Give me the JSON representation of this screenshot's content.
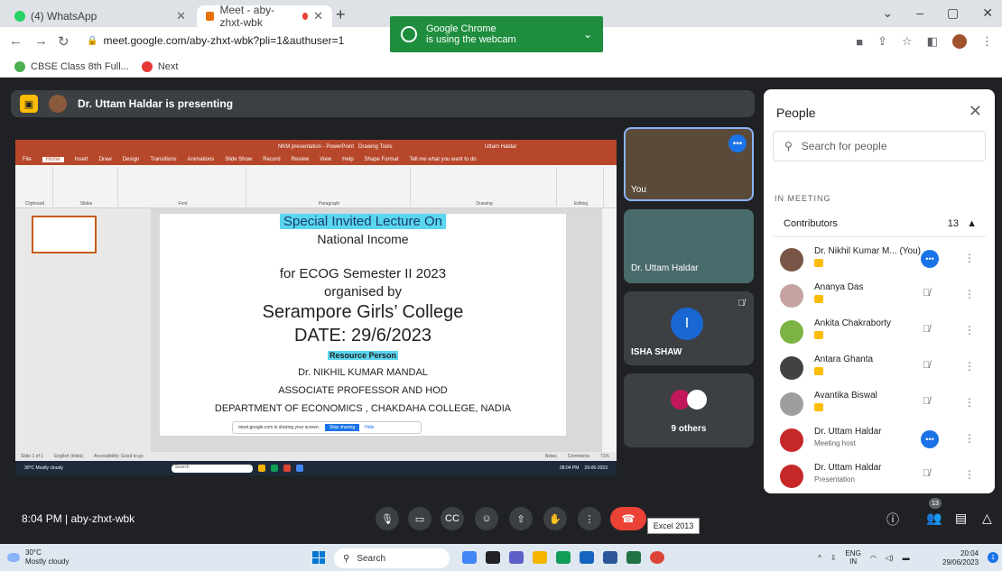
{
  "browser": {
    "tabs": [
      {
        "label": "(4) WhatsApp"
      },
      {
        "label": "Meet - aby-zhxt-wbk"
      }
    ],
    "notice": {
      "line1": "Google Chrome",
      "line2": "is using the webcam"
    },
    "url": "meet.google.com/aby-zhxt-wbk?pli=1&authuser=1",
    "bookmarks": [
      {
        "label": "CBSE Class 8th Full..."
      },
      {
        "label": "Next"
      }
    ]
  },
  "meet": {
    "presenting": "Dr. Uttam Haldar is presenting",
    "meeting_code": "8:04 PM  |  aby-zhxt-wbk",
    "tooltip": "Excel 2013",
    "participants_badge": "13"
  },
  "powerpoint": {
    "title": "NKM presentation - PowerPoint",
    "drawing_tools": "Drawing Tools",
    "user": "Uttam Haldar",
    "tabs": [
      "File",
      "Home",
      "Insert",
      "Draw",
      "Design",
      "Transitions",
      "Animations",
      "Slide Show",
      "Record",
      "Review",
      "View",
      "Help",
      "Shape Format"
    ],
    "tell_me": "Tell me what you want to do",
    "groups": [
      "Clipboard",
      "Slides",
      "Font",
      "Paragraph",
      "Drawing",
      "Editing"
    ],
    "status": [
      "Slide 1 of 1",
      "English (India)",
      "Accessibility: Good to go",
      "Notes",
      "Comments",
      "71%"
    ],
    "share_text": "meet.google.com is sharing your screen.",
    "stop_sharing": "Stop sharing",
    "hide": "Hide",
    "taskbar_weather": "30°C Mostly cloudy",
    "taskbar_search": "Search",
    "taskbar_time": "08:04 PM",
    "taskbar_date": "29-06-2023"
  },
  "slide": {
    "line1": "Special Invited Lecture  On",
    "line2": "National Income",
    "line3": "for    ECOG Semester II 2023",
    "line4": "organised by",
    "line5": "Serampore Girls’ College",
    "line6": "DATE: 29/6/2023",
    "line7": "Resource Person",
    "line8": "Dr. NIKHIL KUMAR MANDAL",
    "line9": "ASSOCIATE PROFESSOR AND HOD",
    "line10": "DEPARTMENT OF ECONOMICS , CHAKDAHA COLLEGE, NADIA"
  },
  "tiles": {
    "you": "You",
    "uttam": "Dr. Uttam Haldar",
    "isha": "ISHA SHAW",
    "isha_initial": "I",
    "others": "9 others"
  },
  "people": {
    "title": "People",
    "search_placeholder": "Search for people",
    "in_meeting": "IN MEETING",
    "contributors_label": "Contributors",
    "contributors_count": "13",
    "list": [
      {
        "name": "Dr. Nikhil Kumar M... (You)",
        "sub": "",
        "color": "#5d4037"
      },
      {
        "name": "Ananya Das",
        "sub": "",
        "color": "#c5a3a3"
      },
      {
        "name": "Ankita Chakraborty",
        "sub": "",
        "color": "#7cb342"
      },
      {
        "name": "Antara Ghanta",
        "sub": "",
        "color": "#424242"
      },
      {
        "name": "Avantika Biswal",
        "sub": "",
        "color": "#9e9e9e"
      },
      {
        "name": "Dr. Uttam Haldar",
        "sub": "Meeting host",
        "color": "#c62828"
      },
      {
        "name": "Dr. Uttam Haldar",
        "sub": "Presentation",
        "color": "#c62828"
      }
    ]
  },
  "windows": {
    "weather_temp": "30°C",
    "weather_desc": "Mostly cloudy",
    "search": "Search",
    "lang1": "ENG",
    "lang2": "IN",
    "time": "20:04",
    "date": "29/06/2023",
    "notifications": "1"
  }
}
